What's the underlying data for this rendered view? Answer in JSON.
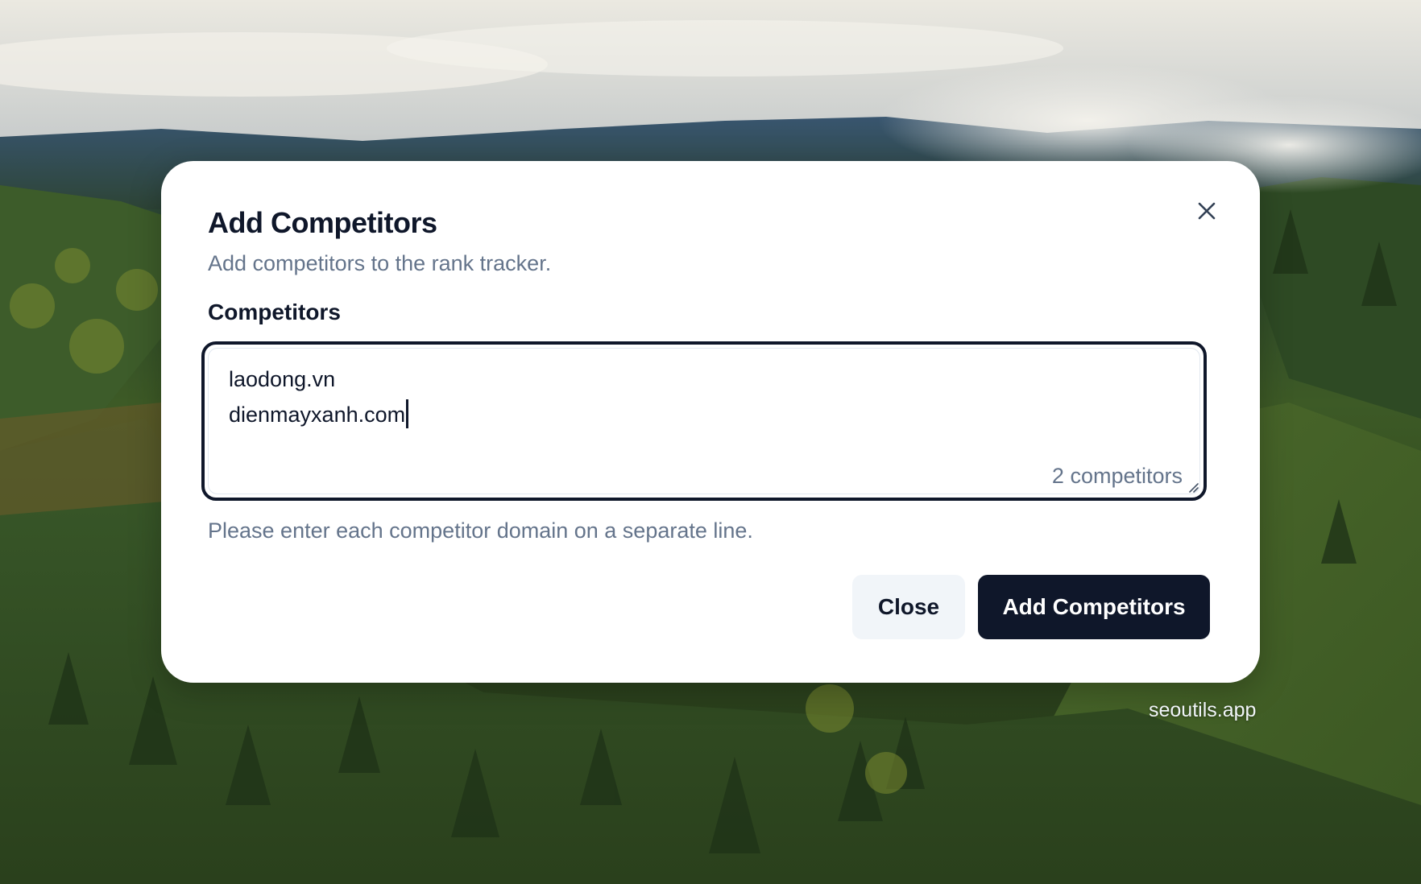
{
  "dialog": {
    "title": "Add Competitors",
    "subtitle": "Add competitors to the rank tracker.",
    "field_label": "Competitors",
    "textarea_lines": [
      "laodong.vn",
      "dienmayxanh.com"
    ],
    "counter": "2 competitors",
    "helper": "Please enter each competitor domain on a separate line.",
    "close_button_label": "Close",
    "submit_button_label": "Add Competitors",
    "close_icon": "close-icon"
  },
  "watermark": "seoutils.app",
  "colors": {
    "primary": "#0f172a",
    "muted_text": "#64748b",
    "secondary_button": "#f1f5f9",
    "surface": "#ffffff"
  }
}
